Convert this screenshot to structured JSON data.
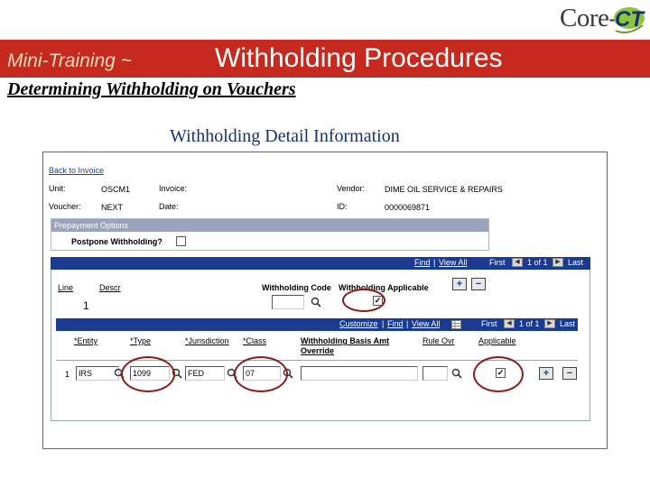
{
  "logo": {
    "core": "Core-",
    "ct": "CT"
  },
  "banner": {
    "subtitle": "Mini-Training ~",
    "title": "Withholding Procedures"
  },
  "page_subtitle": "Determining Withholding on Vouchers",
  "section_title": "Withholding Detail Information",
  "screen": {
    "back_link": "Back to Invoice",
    "labels": {
      "unit": "Unit:",
      "invoice": "Invoice:",
      "vendor": "Vendor:",
      "voucher": "Voucher:",
      "date": "Date:",
      "id": "ID:"
    },
    "values": {
      "unit": "OSCM1",
      "voucher": "NEXT",
      "vendor": "DIME OIL SERVICE & REPAIRS",
      "id": "0000069871"
    },
    "prepayment": {
      "header": "Prepayment Options",
      "postpone_label": "Postpone Withholding?"
    },
    "line_bar": {
      "find": "Find",
      "view_all": "View All",
      "first": "First",
      "counter": "1 of 1",
      "last": "Last"
    },
    "line_section": {
      "line_label": "Line",
      "descr_label": "Descr",
      "line_value": "1",
      "wh_code_label": "Withholding Code",
      "wh_applicable_label": "Withholding Applicable"
    },
    "detail_bar": {
      "customize": "Customize",
      "find": "Find",
      "view_all": "View All",
      "first": "First",
      "counter": "1 of 1",
      "last": "Last"
    },
    "columns": {
      "entity": "*Entity",
      "type": "*Type",
      "jurisdiction": "*Jurisdiction",
      "class": "*Class",
      "basis_line1": "Withholding Basis Amt",
      "basis_line2": "Override",
      "rule_ovr": "Rule Ovr",
      "applicable": "Applicable"
    },
    "row": {
      "num": "1",
      "entity": "IRS",
      "type": "1099",
      "jurisdiction": "FED",
      "class": "07"
    }
  },
  "colors": {
    "banner": "#c62a1e",
    "bar": "#1a3b8f",
    "circle": "#8b1a1a"
  }
}
